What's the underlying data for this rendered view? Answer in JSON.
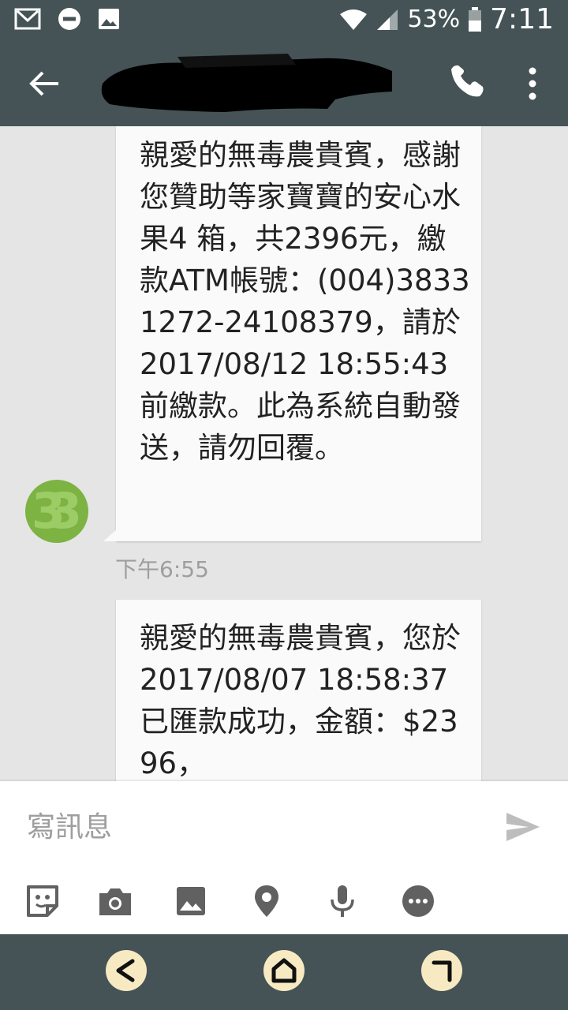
{
  "status_bar": {
    "icons": [
      "gmail-icon",
      "do-not-disturb-icon",
      "image-icon",
      "wifi-icon",
      "signal-icon",
      "battery-icon"
    ],
    "battery": "53%",
    "time": "7:11"
  },
  "app_bar": {
    "icons": [
      "back-arrow-icon",
      "phone-icon",
      "more-vert-icon"
    ]
  },
  "messages": [
    {
      "text": "親愛的無毒農貴賓，感謝您贊助等家寶寶的安心水果4 箱，共2396元，繳款ATM帳號：(004)38331272-24108379，請於2017/08/12 18:55:43前繳款。此為系統自動發送，請勿回覆。",
      "timestamp": "下午6:55"
    },
    {
      "text": "親愛的無毒農貴賓，您於 2017/08/07 18:58:37 已匯款成功，金額：$2396，"
    }
  ],
  "composer": {
    "placeholder": "寫訊息",
    "attach_icons": [
      "sticker-icon",
      "camera-icon",
      "gallery-icon",
      "location-icon",
      "microphone-icon",
      "more-options-icon"
    ]
  },
  "nav_bar": {
    "icons": [
      "nav-back-icon",
      "nav-home-icon",
      "nav-recents-icon"
    ]
  },
  "colors": {
    "bar": "#455356",
    "thread_bg": "#e5e5e5",
    "bubble": "#fafafa",
    "avatar": "#7cb342",
    "nav_button": "#f7eac2"
  }
}
